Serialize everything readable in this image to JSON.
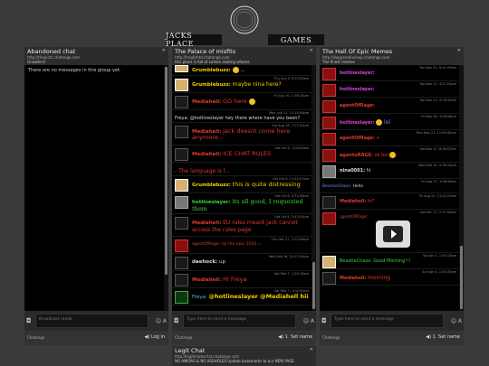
{
  "nav": {
    "home_label": "JACKS PLACE",
    "games_label": "GAMES"
  },
  "icons": {
    "logo": "circle-logo-icon",
    "close": "×",
    "camera": "camera-icon",
    "emoji": "smiley-icon",
    "font": "font-size-icon",
    "sound": "speaker-icon"
  },
  "colors": {
    "bg": "#3a3a3a",
    "panel": "#000000",
    "red_text": "#e23a2a",
    "yellow_text": "#f0d000",
    "green_text": "#38d838",
    "blue_text": "#6a8cff",
    "cyan_text": "#4ac0e8",
    "magenta_text": "#e040e0"
  },
  "panels": {
    "abandoned": {
      "title": "Abandoned chat",
      "url": "http://thepictc.chatango.com",
      "desc": "Growltech",
      "empty": "There are no messages in this group yet.",
      "compose_placeholder": "Broadcast mode",
      "brand": "Chatango",
      "login": "Log in"
    },
    "misfits": {
      "title": "The Palace of misfits",
      "url": "http://hnglishtd.chatango.com",
      "desc": "this place is full of Lomen skating whores",
      "compose_placeholder": "Type here to send a message",
      "brand": "Chatango",
      "set_name": "Set name",
      "num": "1",
      "messages": [
        {
          "user": "Grumblebuzz:",
          "text": "...",
          "time": ""
        },
        {
          "user": "Grumblebuzz:",
          "text": "maybe nina here?",
          "time": "Thu July 9, 9:24:03am"
        },
        {
          "user": "Mediahell:",
          "text": "GG here",
          "time": "Fri July 10, 1:16:15pm"
        },
        {
          "user": "Freya:",
          "text": "@hotlineslayer hey there where have you been?",
          "time": "Mon July 21, 12:15:00pm"
        },
        {
          "user": "Mediahell:",
          "text": "jack doesnt come here anymore...",
          "time": "Sat Aug 16, 7:27:01pm"
        },
        {
          "user": "Mediahell:",
          "text": "ICE CHAT RULES",
          "time": "Sat Oct 6, 1:04:00am"
        },
        {
          "user": "",
          "text": "- The language is l...",
          "time": ""
        },
        {
          "user": "Grumblebuzz:",
          "text": "this is quite distressing",
          "time": "Sat Oct 6, 11:41:07am"
        },
        {
          "user": "hotlineslayer:",
          "text": "its all good, I requested them",
          "time": "Sat Oct 6, 3:31:09pm"
        },
        {
          "user": "Mediahell:",
          "text": "EU rules meant jack cannot access the rules page",
          "time": "Sat Oct 6, 3:43:02pm"
        },
        {
          "user": "agentOfRage:",
          "text": "rip the epic 2018 =",
          "time": "Thu Dec 27, 2:37:56am"
        },
        {
          "user": "daehock:",
          "text": "up",
          "time": "Wed Feb 16, 10:12:30pm"
        },
        {
          "user": "Mediahell:",
          "text": "Hi Freya",
          "time": "Sat Mar 7, 1:20:13am"
        },
        {
          "user": "Freya:",
          "text": "@hotlineslayer @Mediahell hii",
          "time": "Sat Mar 7, 1:02:30am"
        }
      ]
    },
    "memes": {
      "title": "The Hall Of Epic Memes",
      "url": "http://dapperedusinep.chatango.com",
      "desc": "The finest memes",
      "compose_placeholder": "Type here to send a message",
      "brand": "Chatango",
      "set_name": "Set name",
      "num": "1",
      "messages": [
        {
          "user": "hotlineslayer:",
          "text": "",
          "time": "Tue Nov 21, 8:41:29am"
        },
        {
          "user": "hotlineslayer:",
          "text": "",
          "time": "Tue Nov 21, 4:17:25pm"
        },
        {
          "user": "agentOfRage:",
          "text": "",
          "time": "Tue Nov 23, 4:76:30am"
        },
        {
          "user": "hotlineslayer:",
          "text": "lol",
          "time": "Fri Nov 26, 3:06:58pm"
        },
        {
          "user": "agentOfRage:",
          "text": "+",
          "time": "Mon Nov 27, 11:05:45pm"
        },
        {
          "user": "agentoRAGE:",
          "text": "ok boi",
          "time": "Sat Nov 11, 6:36:57pm"
        },
        {
          "user": "nina0001:",
          "text": "hi",
          "time": "Wed Feb 14, 9:36:33pm"
        },
        {
          "user": "BeastieChaos:",
          "text": "Hello",
          "time": "Fri Aug 17, 1:08:36am"
        },
        {
          "user": "Mediahell:",
          "text": "hi?",
          "time": "Fri Aug 31, 11:42:23am"
        },
        {
          "user": "agentOfRage:",
          "text": "",
          "time": "Sat Dec 27, 2:37:56am"
        },
        {
          "user": "BeastieChaos:",
          "text": "Good Morning!!!",
          "time": "Tue Jan 1, 1:55:15pm"
        },
        {
          "user": "Mediahell:",
          "text": "morning",
          "time": "Sun Jan 6, 1:55:33pm"
        }
      ]
    },
    "legit": {
      "title": "Legit Chat",
      "url": "http://legitimatechat.chatango.com",
      "desc": "NO ANIOAS & NO ASSHOLES Update bookmarks to our NEW PAGE"
    }
  }
}
